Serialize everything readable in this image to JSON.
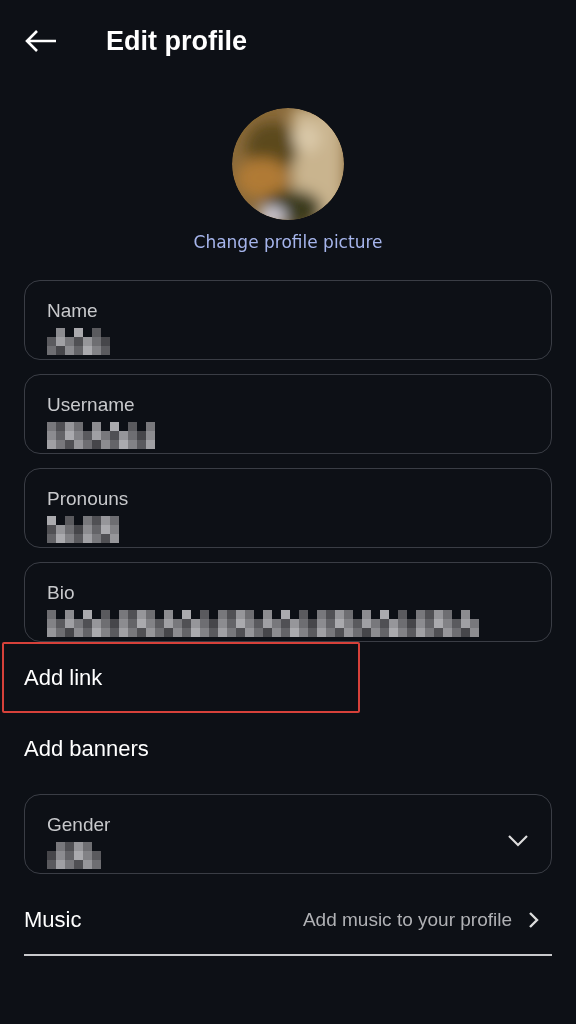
{
  "header": {
    "title": "Edit profile"
  },
  "avatar": {
    "kind": "picture",
    "action": "Change profile picture"
  },
  "fields": [
    {
      "kind": "text",
      "label": "Name",
      "redacted": true
    },
    {
      "kind": "text",
      "label": "Username",
      "redacted": true
    },
    {
      "kind": "text",
      "label": "Pronouns",
      "redacted": true
    },
    {
      "kind": "text",
      "label": "Bio",
      "redacted": true
    }
  ],
  "links": [
    {
      "label": "Add link",
      "highlighted": true
    },
    {
      "label": "Add banners",
      "highlighted": false
    }
  ],
  "gender": {
    "kind": "dropdown",
    "label": "Gender",
    "redacted": true
  },
  "music": {
    "label": "Music",
    "hint": "Add music to your profile"
  }
}
